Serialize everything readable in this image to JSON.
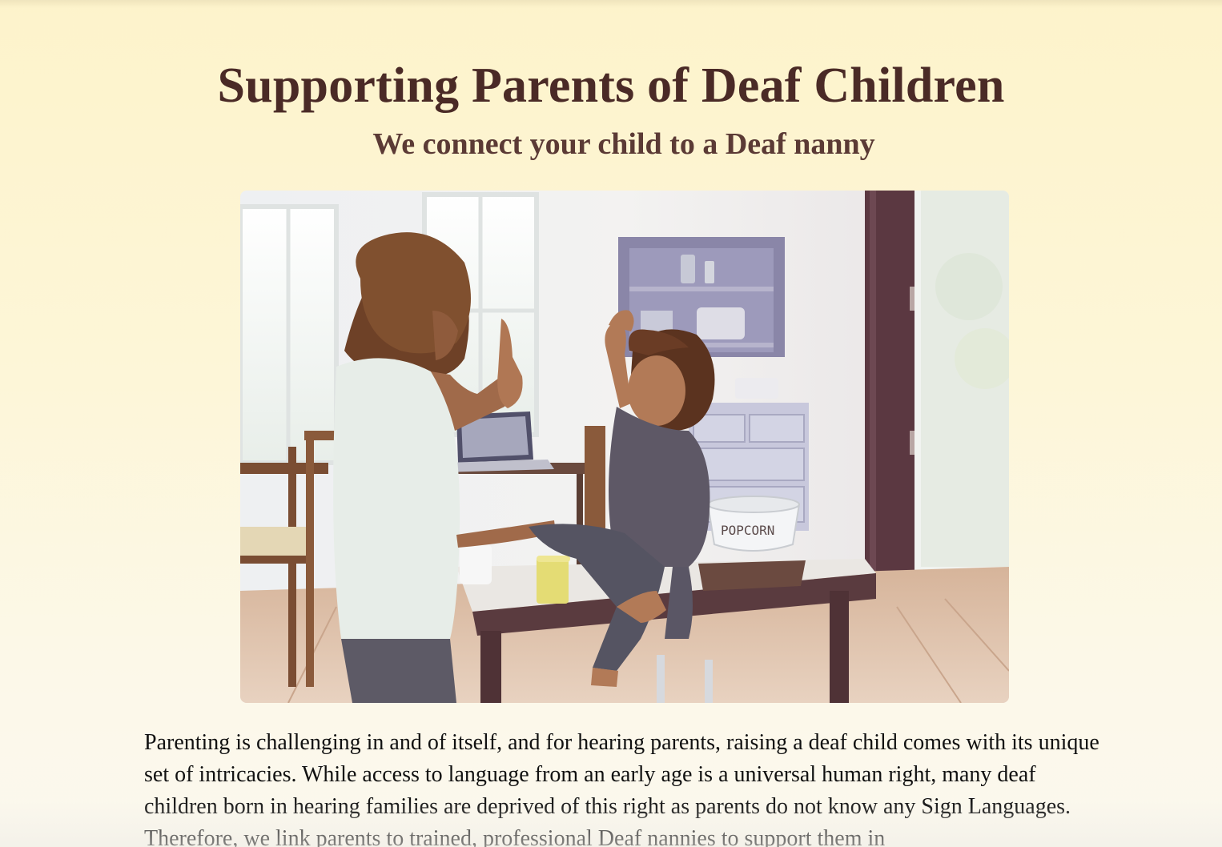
{
  "page": {
    "title": "Supporting Parents of Deaf Children",
    "subtitle": "We connect your child to a Deaf nanny"
  },
  "hero_image": {
    "popcorn_label": "POPCORN"
  },
  "intro": {
    "text": "Parenting is challenging in and of itself, and for hearing parents, raising a deaf child comes with its unique set of intricacies. While access to language from an early age is a universal human right, many deaf children born in hearing families are deprived of this right as parents do not know any Sign Languages. Therefore, we link parents to trained, professional Deaf nannies to support them in"
  },
  "colors": {
    "title": "#4a2a26",
    "subtitle": "#5b3a35",
    "body_text": "#111111",
    "background_top": "#fdf3cb",
    "background_bottom": "#fbf8ee"
  }
}
